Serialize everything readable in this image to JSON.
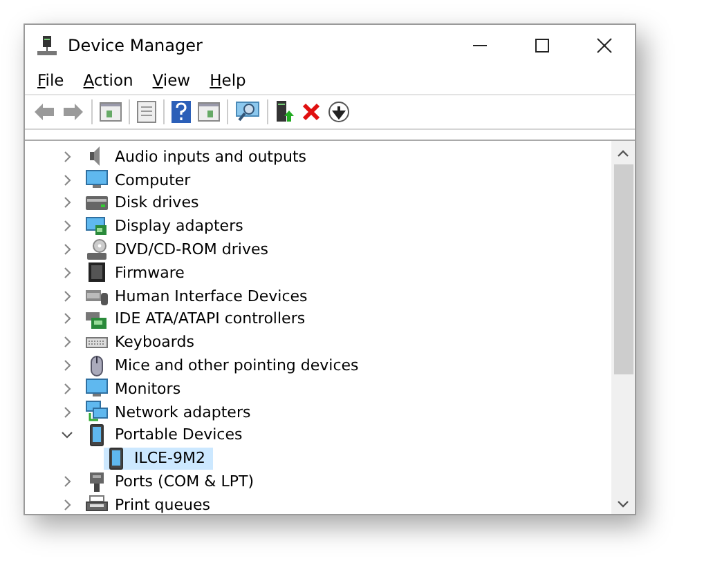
{
  "window": {
    "title": "Device Manager"
  },
  "menu": [
    "File",
    "Action",
    "View",
    "Help"
  ],
  "tree": [
    {
      "label": "Audio inputs and outputs",
      "kind": "speaker",
      "expanded": false,
      "selected": false
    },
    {
      "label": "Computer",
      "kind": "monitor",
      "expanded": false,
      "selected": false
    },
    {
      "label": "Disk drives",
      "kind": "disk",
      "expanded": false,
      "selected": false
    },
    {
      "label": "Display adapters",
      "kind": "display",
      "expanded": false,
      "selected": false
    },
    {
      "label": "DVD/CD-ROM drives",
      "kind": "dvd",
      "expanded": false,
      "selected": false
    },
    {
      "label": "Firmware",
      "kind": "chip",
      "expanded": false,
      "selected": false
    },
    {
      "label": "Human Interface Devices",
      "kind": "hid",
      "expanded": false,
      "selected": false
    },
    {
      "label": "IDE ATA/ATAPI controllers",
      "kind": "card",
      "expanded": false,
      "selected": false
    },
    {
      "label": "Keyboards",
      "kind": "keyboard",
      "expanded": false,
      "selected": false
    },
    {
      "label": "Mice and other pointing devices",
      "kind": "mouse",
      "expanded": false,
      "selected": false
    },
    {
      "label": "Monitors",
      "kind": "monitor",
      "expanded": false,
      "selected": false
    },
    {
      "label": "Network adapters",
      "kind": "network",
      "expanded": false,
      "selected": false
    },
    {
      "label": "Portable Devices",
      "kind": "phone",
      "expanded": true,
      "selected": false,
      "children": [
        {
          "label": "ILCE-9M2",
          "kind": "phone",
          "selected": true
        }
      ]
    },
    {
      "label": "Ports (COM & LPT)",
      "kind": "port",
      "expanded": false,
      "selected": false
    },
    {
      "label": "Print queues",
      "kind": "printer",
      "expanded": false,
      "selected": false
    }
  ]
}
